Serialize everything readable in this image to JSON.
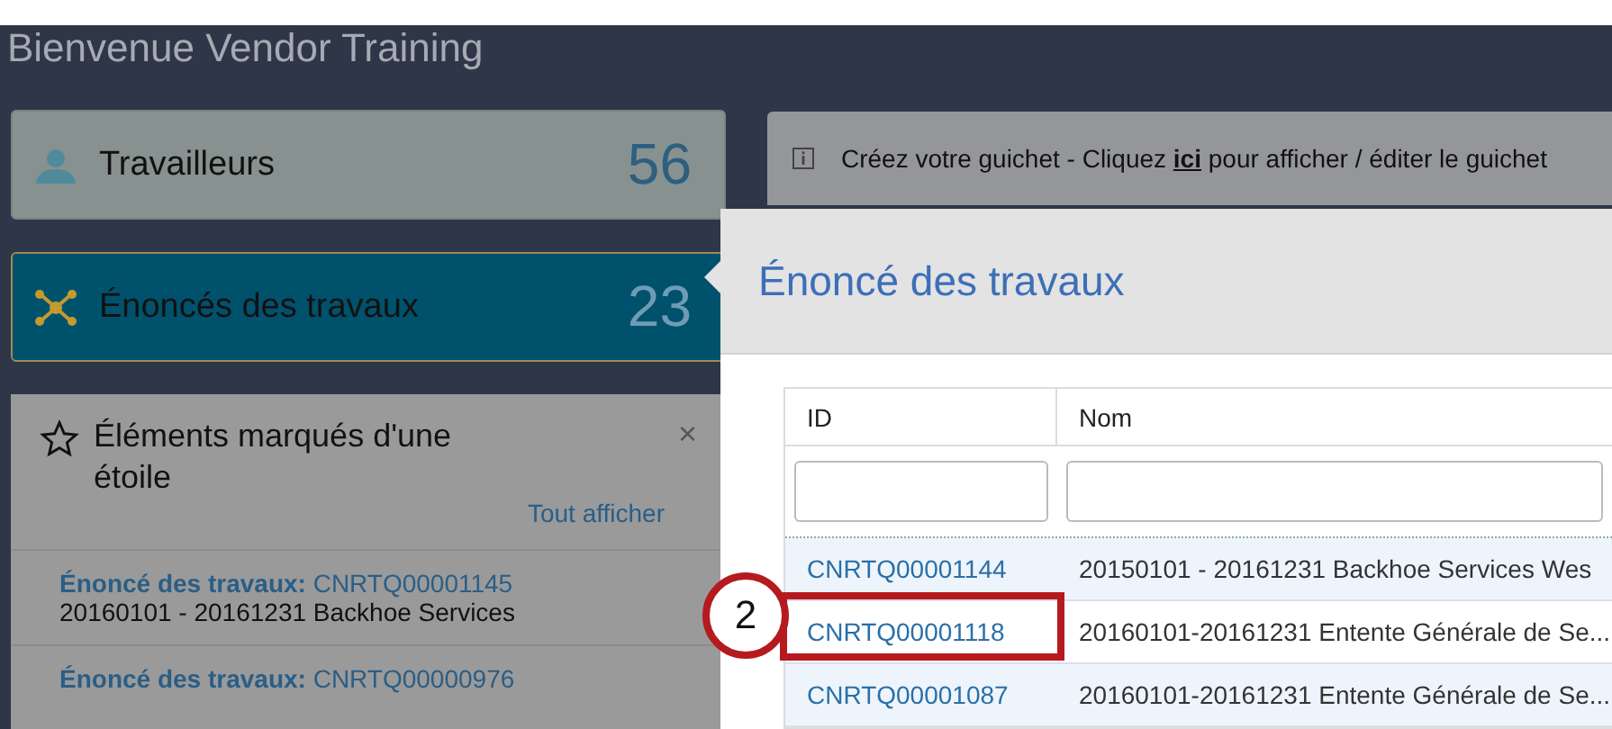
{
  "header": {
    "title": "Bienvenue Vendor Training"
  },
  "tiles": [
    {
      "kind": "person",
      "label": "Travailleurs",
      "count": "56",
      "selected": false
    },
    {
      "kind": "network",
      "label": "Énoncés des travaux",
      "count": "23",
      "selected": true
    }
  ],
  "starred": {
    "title": "Éléments marqués d'une étoile",
    "close": "×",
    "show_all": "Tout afficher",
    "items": [
      {
        "type_label": "Énoncé des travaux:",
        "id": "CNRTQ00001145",
        "name": "20160101 - 20161231 Backhoe Services"
      },
      {
        "type_label": "Énoncé des travaux:",
        "id": "CNRTQ00000976"
      }
    ]
  },
  "banner": {
    "text": "Créez votre guichet - Cliquez **ici** pour afficher / éditer le guichet"
  },
  "panel": {
    "title": "Énoncé des travaux",
    "table": {
      "columns": [
        "ID",
        "Nom"
      ],
      "rows": [
        {
          "id": "CNRTQ00001144",
          "name": "20150101 - 20161231 Backhoe Services Wes",
          "highlighted": false
        },
        {
          "id": "CNRTQ00001118",
          "name": "20160101-20161231 Entente Générale de Se...",
          "highlighted": true,
          "callout": "2"
        },
        {
          "id": "CNRTQ00001087",
          "name": "20160101-20161231 Entente Générale de Se...",
          "highlighted": false
        }
      ]
    }
  }
}
